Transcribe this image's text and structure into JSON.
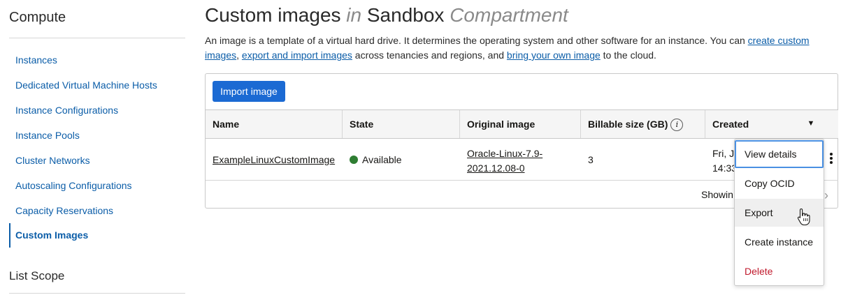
{
  "sidebar": {
    "title": "Compute",
    "items": [
      {
        "label": "Instances"
      },
      {
        "label": "Dedicated Virtual Machine Hosts"
      },
      {
        "label": "Instance Configurations"
      },
      {
        "label": "Instance Pools"
      },
      {
        "label": "Cluster Networks"
      },
      {
        "label": "Autoscaling Configurations"
      },
      {
        "label": "Capacity Reservations"
      },
      {
        "label": "Custom Images"
      }
    ],
    "active_item": "Custom Images",
    "list_scope_title": "List Scope"
  },
  "header": {
    "title_main": "Custom images",
    "title_in": "in",
    "title_compartment": "Sandbox",
    "title_suffix": "Compartment"
  },
  "description": {
    "part1": "An image is a template of a virtual hard drive. It determines the operating system and other software for an instance. You can ",
    "link1": "create custom images",
    "part2": ", ",
    "link2": "export and import images",
    "part3": " across tenancies and regions, and ",
    "link3": "bring your own image",
    "part4": " to the cloud."
  },
  "toolbar": {
    "import_label": "Import image"
  },
  "table": {
    "columns": [
      "Name",
      "State",
      "Original image",
      "Billable size (GB)",
      "Created"
    ],
    "info_icon": "info-icon",
    "sort_icon": "caret-down-icon",
    "rows": [
      {
        "name": "ExampleLinuxCustomImage",
        "state": "Available",
        "state_color": "#2e7d32",
        "original_image_line1": "Oracle-Linux-7.9-",
        "original_image_line2": "2021.12.08-0",
        "billable_size": "3",
        "created_line1": "Fri, J",
        "created_line2": "14:33"
      }
    ],
    "footer_showing": "Showin"
  },
  "context_menu": {
    "items": [
      {
        "label": "View details",
        "state": "focused"
      },
      {
        "label": "Copy OCID"
      },
      {
        "label": "Export",
        "state": "hovered"
      },
      {
        "label": "Create instance"
      },
      {
        "label": "Delete",
        "style": "danger"
      }
    ]
  },
  "colors": {
    "accent": "#1b6ad3",
    "link": "#0b5da8",
    "danger": "#c0192c",
    "available": "#2e7d32"
  }
}
